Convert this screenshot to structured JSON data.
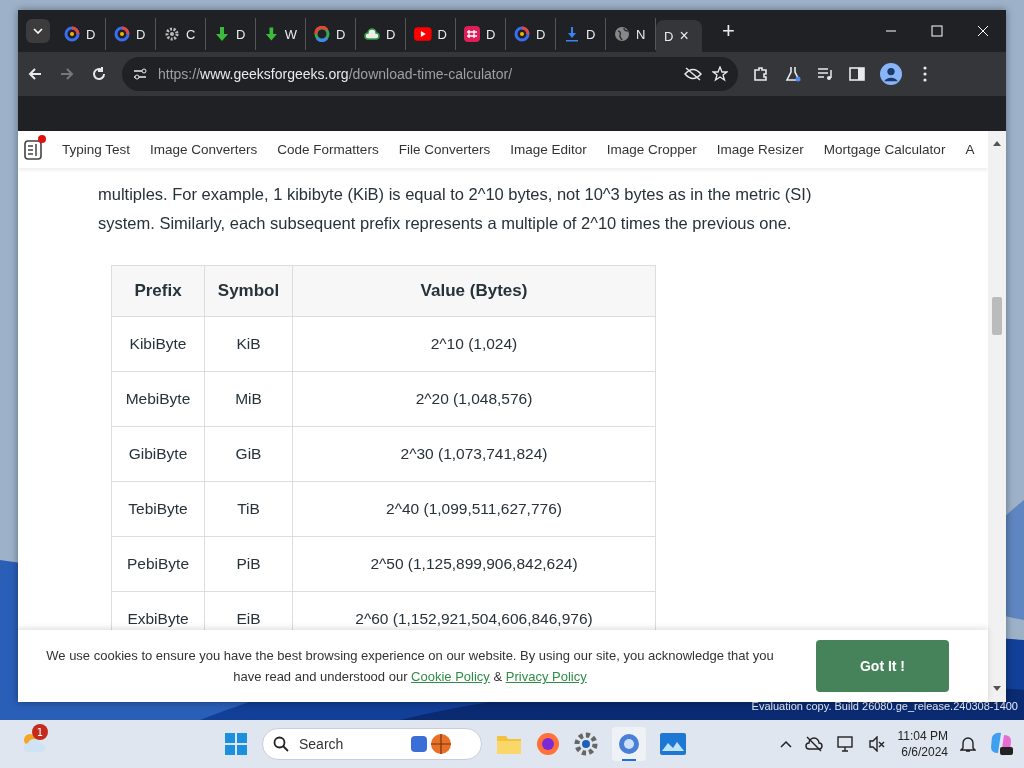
{
  "browser": {
    "tabs": [
      {
        "label": "D",
        "kind": "ring",
        "selected": false
      },
      {
        "label": "D",
        "kind": "ring",
        "selected": false
      },
      {
        "label": "C",
        "kind": "gear",
        "selected": false
      },
      {
        "label": "D",
        "kind": "green-arrow",
        "selected": false
      },
      {
        "label": "W",
        "kind": "green-arrow",
        "selected": false
      },
      {
        "label": "D",
        "kind": "multi-ring",
        "selected": false
      },
      {
        "label": "D",
        "kind": "cloud",
        "selected": false
      },
      {
        "label": "D",
        "kind": "play",
        "selected": false
      },
      {
        "label": "D",
        "kind": "hash",
        "selected": false
      },
      {
        "label": "D",
        "kind": "ring",
        "selected": false
      },
      {
        "label": "D",
        "kind": "download",
        "selected": false
      },
      {
        "label": "N",
        "kind": "globe",
        "selected": false
      },
      {
        "label": "D",
        "kind": "none",
        "selected": true
      }
    ],
    "close_tab": "×",
    "new_tab": "+",
    "url": {
      "prefix": "https://",
      "domain": "www.geeksforgeeks.org",
      "path": "/download-time-calculator/"
    }
  },
  "page": {
    "nav_links": [
      "Typing Test",
      "Image Converters",
      "Code Formatters",
      "File Converters",
      "Image Editor",
      "Image Cropper",
      "Image Resizer",
      "Mortgage Calculator",
      "A"
    ],
    "paragraph_lines": [
      "multiples. For example, 1 kibibyte (KiB) is equal to 2^10 bytes, not 10^3 bytes as in the metric (SI)",
      "system. Similarly, each subsequent prefix represents a multiple of 2^10 times the previous one."
    ],
    "table": {
      "columns": [
        "Prefix",
        "Symbol",
        "Value (Bytes)"
      ],
      "rows": [
        [
          "KibiByte",
          "KiB",
          "2^10 (1,024)"
        ],
        [
          "MebiByte",
          "MiB",
          "2^20 (1,048,576)"
        ],
        [
          "GibiByte",
          "GiB",
          "2^30 (1,073,741,824)"
        ],
        [
          "TebiByte",
          "TiB",
          "2^40 (1,099,511,627,776)"
        ],
        [
          "PebiByte",
          "PiB",
          "2^50 (1,125,899,906,842,624)"
        ],
        [
          "ExbiByte",
          "EiB",
          "2^60 (1,152,921,504,606,846,976)"
        ]
      ]
    },
    "cookie_banner": {
      "line_1": "We use cookies to ensure you have the best browsing experience on our website. By using our site, you acknowledge that you",
      "line_2_start": "have read and understood our",
      "cookie_link": "Cookie Policy",
      "separator": "&",
      "privacy_link": "Privacy Policy",
      "button": "Got It !"
    }
  },
  "desktop": {
    "watermark": "Evaluation copy. Build 26080.ge_release.240308-1400"
  },
  "taskbar": {
    "weather_badge": "1",
    "search_placeholder": "Search",
    "time": "11:04 PM",
    "date": "6/6/2024"
  }
}
